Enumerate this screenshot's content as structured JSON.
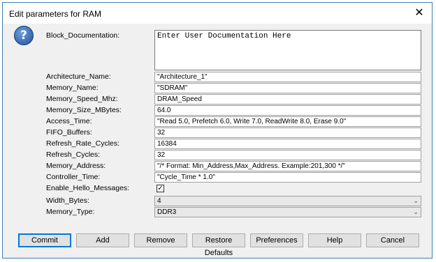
{
  "window": {
    "title": "Edit parameters for RAM",
    "close_glyph": "✕"
  },
  "help_icon": {
    "glyph": "?"
  },
  "block_documentation": {
    "label": "Block_Documentation:",
    "value": "Enter User Documentation Here"
  },
  "fields": [
    {
      "label": "Architecture_Name:",
      "value": "\"Architecture_1\""
    },
    {
      "label": "Memory_Name:",
      "value": "\"SDRAM\""
    },
    {
      "label": "Memory_Speed_Mhz:",
      "value": "DRAM_Speed"
    },
    {
      "label": "Memory_Size_MBytes:",
      "value": "64.0"
    },
    {
      "label": "Access_Time:",
      "value": "\"Read 5.0, Prefetch 6.0, Write 7.0, ReadWrite 8.0, Erase 9.0\""
    },
    {
      "label": "FIFO_Buffers:",
      "value": "32"
    },
    {
      "label": "Refresh_Rate_Cycles:",
      "value": "16384"
    },
    {
      "label": "Refresh_Cycles:",
      "value": "32"
    },
    {
      "label": "Memory_Address:",
      "value": "\"/* Format: Min_Address,Max_Address. Example:201,300 */\""
    },
    {
      "label": "Controller_Time:",
      "value": "\"Cycle_Time * 1.0\""
    }
  ],
  "enable_hello": {
    "label": "Enable_Hello_Messages:",
    "checked_glyph": "✓"
  },
  "width_bytes": {
    "label": "Width_Bytes:",
    "value": "4"
  },
  "memory_type": {
    "label": "Memory_Type:",
    "value": "DDR3"
  },
  "chevron_glyph": "⌄",
  "buttons": {
    "commit": "Commit",
    "add": "Add",
    "remove": "Remove",
    "restore_defaults": "Restore Defaults",
    "preferences": "Preferences",
    "help": "Help",
    "cancel": "Cancel"
  }
}
